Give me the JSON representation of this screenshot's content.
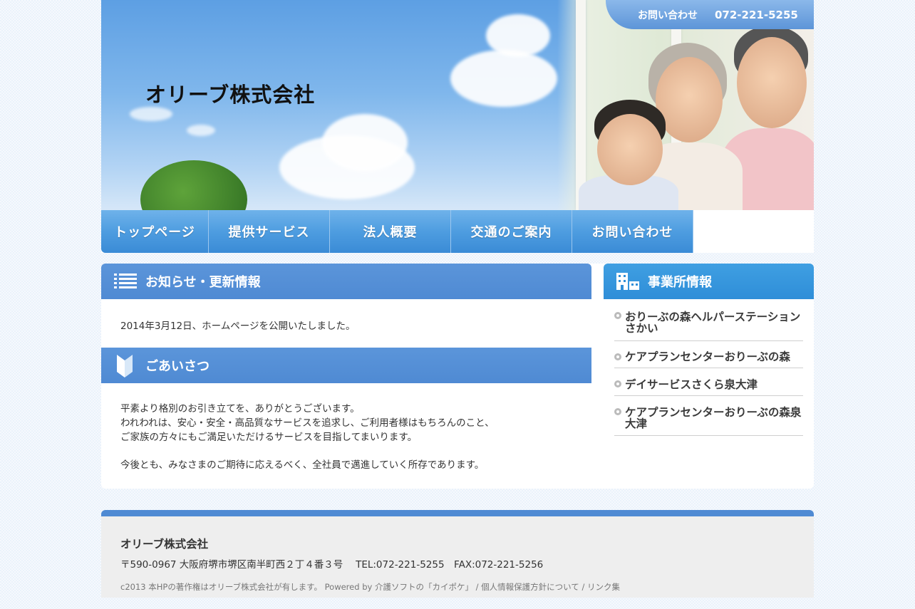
{
  "header": {
    "site_title": "オリーブ株式会社",
    "contact_label": "お問い合わせ",
    "contact_tel": "072-221-5255"
  },
  "nav": {
    "items": [
      {
        "label": "トップページ"
      },
      {
        "label": "提供サービス"
      },
      {
        "label": "法人概要"
      },
      {
        "label": "交通のご案内"
      },
      {
        "label": "お問い合わせ"
      }
    ]
  },
  "news": {
    "heading": "お知らせ・更新情報",
    "item": "2014年3月12日、ホームページを公開いたしました。"
  },
  "greeting": {
    "heading": "ごあいさつ",
    "line1": "平素より格別のお引き立てを、ありがとうございます。",
    "line2": "われわれは、安心・安全・高品質なサービスを追求し、ご利用者様はもちろんのこと、",
    "line3": "ご家族の方々にもご満足いただけるサービスを目指してまいります。",
    "line4": "今後とも、みなさまのご期待に応えるべく、全社員で邁進していく所存であります。"
  },
  "sidebar": {
    "heading": "事業所情報",
    "items": [
      {
        "label": "おりーぶの森ヘルパーステーションさかい"
      },
      {
        "label": "ケアプランセンターおりーぶの森"
      },
      {
        "label": "デイサービスさくら泉大津"
      },
      {
        "label": "ケアプランセンターおりーぶの森泉大津"
      }
    ]
  },
  "footer": {
    "company": "オリーブ株式会社",
    "address": "〒590-0967 大阪府堺市堺区南半町西２丁４番３号　 TEL:072-221-5255　FAX:072-221-5256",
    "copyright": "c2013 本HPの著作権はオリーブ株式会社が有します。 Powered by 介護ソフトの「カイポケ」 / 個人情報保護方針について / リンク集"
  },
  "colors": {
    "nav_blue": "#4e9de0",
    "section_blue": "#4f8ad3",
    "side_blue": "#2f8ed8"
  }
}
